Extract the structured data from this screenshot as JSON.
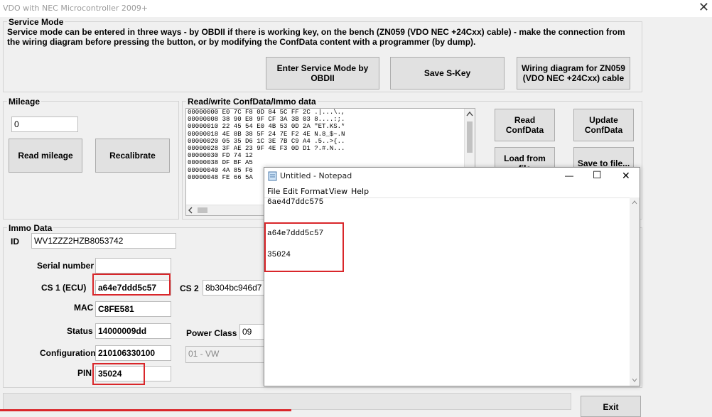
{
  "window": {
    "title": "VDO with NEC Microcontroller 2009+",
    "close": "✕"
  },
  "service_mode": {
    "legend": "Service Mode",
    "description": "Service mode can be entered in three ways - by OBDII if there is working key, on the bench (ZN059 (VDO NEC +24Cxx) cable) - make the connection from the wiring diagram before pressing the button, or by modifying the ConfData content with a programmer (by dump).",
    "btn_enter": "Enter Service Mode by OBDII",
    "btn_save_skey": "Save S-Key",
    "btn_wiring": "Wiring diagram for ZN059 (VDO NEC +24Cxx) cable"
  },
  "mileage": {
    "legend": "Mileage",
    "value": "0",
    "btn_read": "Read mileage",
    "btn_recalibrate": "Recalibrate"
  },
  "confdata": {
    "legend": "Read/write ConfData/Immo data",
    "rows": [
      "00000000 E0 7C F8 0D 84 5C FF 2C .|...\\.,",
      "00000008 38 90 E8 9F CF 3A 3B 03 8....:;.",
      "00000010 22 45 54 E0 4B 53 0D 2A \"ET.KS.*",
      "00000018 4E 8B 38 5F 24 7E F2 4E N.8_$~.N",
      "00000020 05 35 D6 1C 3E 7B C9 A4 .5..>{..",
      "00000028 3F AE 23 9F 4E F3 0D D1 ?.#.N...",
      "00000030 FD 74 12",
      "00000038 DF BF A5",
      "00000040 4A 85 F6",
      "00000048 FE 66 5A"
    ],
    "btn_read": "Read ConfData",
    "btn_update": "Update ConfData",
    "btn_load": "Load from file",
    "btn_save": "Save to file..."
  },
  "immo": {
    "legend": "Immo Data",
    "id_label": "ID",
    "id_value": "WV1ZZZ2HZB8053742",
    "serial_label": "Serial number",
    "serial_value": "",
    "cs1_label": "CS 1 (ECU)",
    "cs1_value": "a64e7ddd5c57",
    "cs2_label": "CS 2",
    "cs2_value": "8b304bc946d7",
    "mac_label": "MAC",
    "mac_value": "C8FE581",
    "status_label": "Status",
    "status_value": "14000009dd",
    "power_class_label": "Power Class",
    "power_class_value": "09",
    "config_label": "Configuration",
    "config_value": "210106330100",
    "brand_value": "01 - VW",
    "pin_label": "PIN",
    "pin_value": "35024"
  },
  "exit_button": "Exit",
  "notepad": {
    "title": "Untitled - Notepad",
    "menu": [
      "File",
      "Edit",
      "Format",
      "View",
      "Help"
    ],
    "lines": [
      "6ae4d7ddc575",
      "a64e7ddd5c57",
      "35024"
    ],
    "minimize": "—",
    "maximize": "☐",
    "close": "✕"
  },
  "colors": {
    "highlight": "#d9262a",
    "background": "#f0f0f0"
  }
}
